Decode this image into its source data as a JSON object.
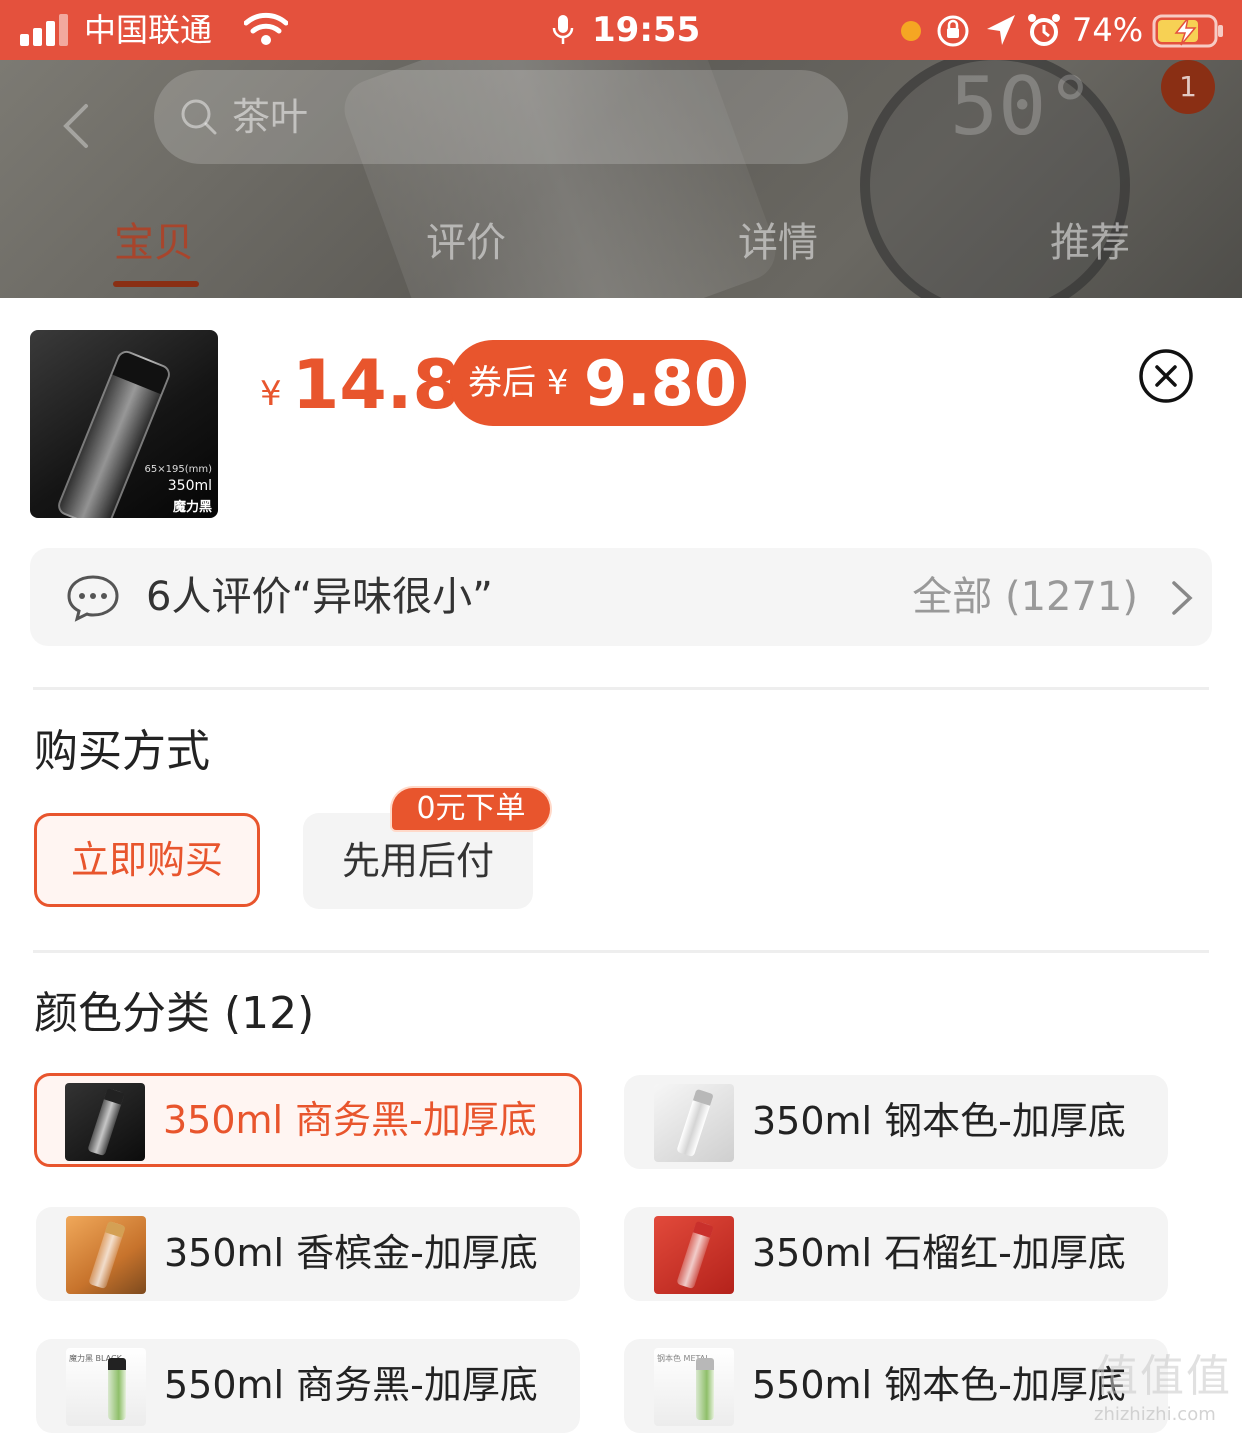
{
  "status_bar": {
    "carrier": "中国联通",
    "time": "19:55",
    "battery_percent": "74%",
    "colors": {
      "background": "#e4513d"
    }
  },
  "header": {
    "search_placeholder": "茶叶",
    "cart_count": "1",
    "background_temp": "50°",
    "tabs": [
      {
        "label": "宝贝",
        "active": true
      },
      {
        "label": "评价",
        "active": false
      },
      {
        "label": "详情",
        "active": false
      },
      {
        "label": "推荐",
        "active": false
      }
    ]
  },
  "product": {
    "thumb_size": "65×195(mm)",
    "thumb_volume": "350ml",
    "thumb_color": "魔力黑",
    "currency": "¥",
    "price": "14.8",
    "coupon_label": "券后 ¥",
    "coupon_price": "9.80"
  },
  "review": {
    "summary": "6人评价“异味很小”",
    "all_label": "全部 (1271)"
  },
  "purchase": {
    "title": "购买方式",
    "buy_now": "立即购买",
    "pay_later": "先用后付",
    "zero_badge": "0元下单"
  },
  "colors_section": {
    "title": "颜色分类 (12)",
    "options": [
      {
        "label": "350ml 商务黑-加厚底",
        "selected": true,
        "image": "black-bottle"
      },
      {
        "label": "350ml 钢本色-加厚底",
        "selected": false,
        "image": "steel-bottle"
      },
      {
        "label": "350ml 香槟金-加厚底",
        "selected": false,
        "image": "gold-bottle"
      },
      {
        "label": "350ml 石榴红-加厚底",
        "selected": false,
        "image": "red-bottle"
      },
      {
        "label": "550ml 商务黑-加厚底",
        "selected": false,
        "image": "black-tea-bottle"
      },
      {
        "label": "550ml 钢本色-加厚底",
        "selected": false,
        "image": "steel-tea-bottle"
      }
    ],
    "image_captions": {
      "black": "魔力黑 BLACK",
      "steel": "钢本色 METAL"
    }
  },
  "watermark": {
    "main": "值值值",
    "sub": "zhizhizhi.com"
  },
  "theme": {
    "accent": "#e8552d",
    "muted_text": "#999999"
  }
}
